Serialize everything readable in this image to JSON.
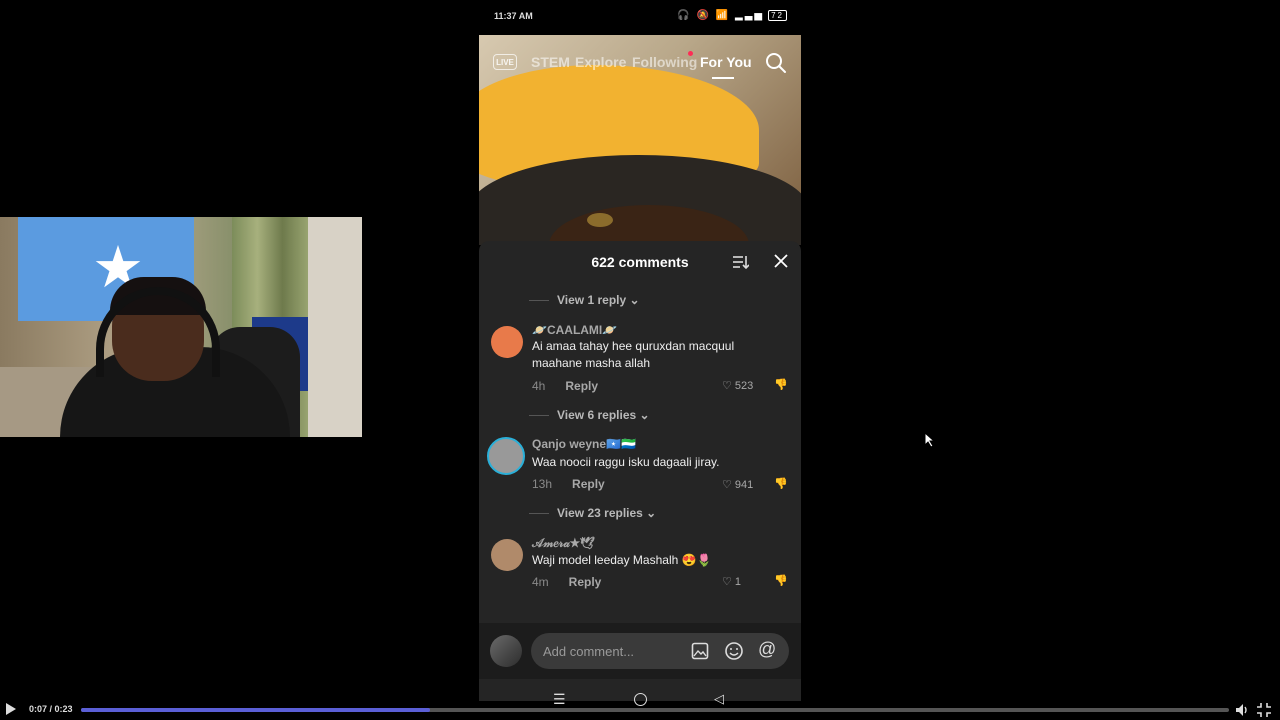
{
  "player": {
    "time": "0:07 / 0:23",
    "progress_fraction": 0.304
  },
  "phone": {
    "status_time": "11:37 AM",
    "battery": "72",
    "tabs": [
      "STEM",
      "Explore",
      "Following",
      "For You"
    ],
    "active_tab": "For You",
    "live_label": "LIVE"
  },
  "comments": {
    "title": "622 comments",
    "view_reply_top": "View 1 reply",
    "items": [
      {
        "name": "🪐CAALAMI🪐",
        "text": "Ai amaa tahay hee quruxdan macquul maahane masha allah",
        "age": "4h",
        "reply": "Reply",
        "likes": "523",
        "view_replies": "View 6 replies"
      },
      {
        "name": "Qanjo weyne🇸🇴🇸🇱",
        "text": "Waa noocii raggu isku dagaali jiray.",
        "age": "13h",
        "reply": "Reply",
        "likes": "941",
        "view_replies": "View 23 replies"
      },
      {
        "name": "𝒜𝓂𝑒𝓇𝒶★🕊",
        "text": "Waji model leeday Mashalh 😍🌷",
        "age": "4m",
        "reply": "Reply",
        "likes": "1"
      }
    ],
    "input_placeholder": "Add comment..."
  }
}
